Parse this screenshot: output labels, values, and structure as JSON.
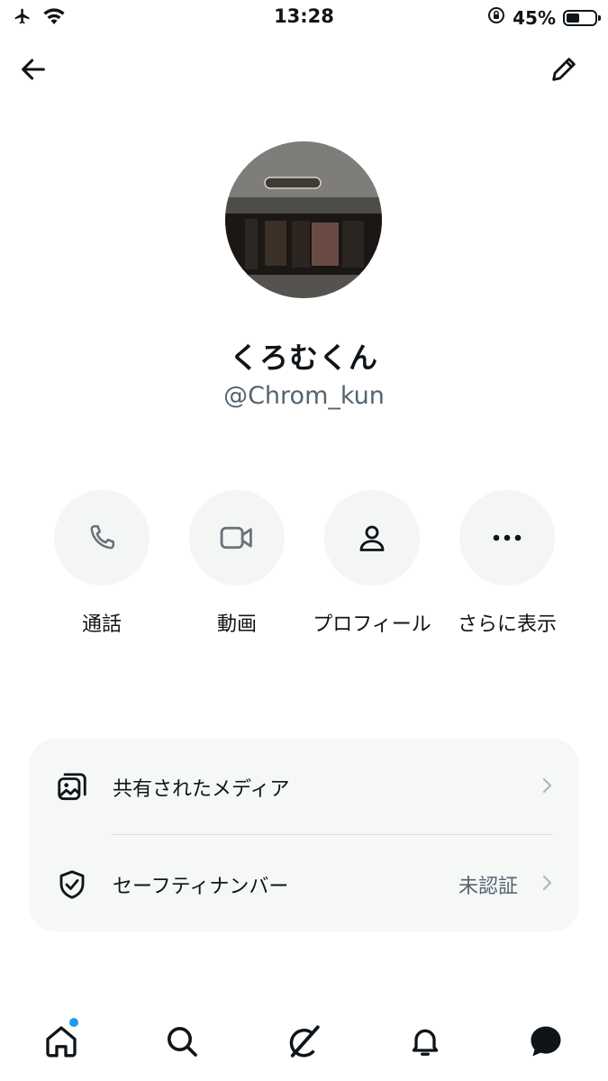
{
  "status_bar": {
    "time": "13:28",
    "battery_percent": "45%",
    "battery_level": 0.45,
    "icons": [
      "airplane-icon",
      "wifi-icon",
      "orientation-lock-icon",
      "battery-icon"
    ]
  },
  "header": {
    "back_icon": "arrow-left-icon",
    "edit_icon": "pencil-icon"
  },
  "profile": {
    "display_name": "くろむくん",
    "handle": "@Chrom_kun"
  },
  "actions": [
    {
      "label": "通話",
      "icon": "phone-icon"
    },
    {
      "label": "動画",
      "icon": "video-camera-icon"
    },
    {
      "label": "プロフィール",
      "icon": "person-icon"
    },
    {
      "label": "さらに表示",
      "icon": "more-dots-icon"
    }
  ],
  "settings": {
    "shared_media": {
      "label": "共有されたメディア",
      "icon": "media-gallery-icon"
    },
    "safety_number": {
      "label": "セーフティナンバー",
      "value": "未認証",
      "icon": "shield-check-icon"
    }
  },
  "tabbar": {
    "items": [
      "home-icon",
      "search-icon",
      "grok-icon",
      "bell-icon",
      "messages-icon"
    ],
    "accent_color": "#1d9bf0"
  }
}
